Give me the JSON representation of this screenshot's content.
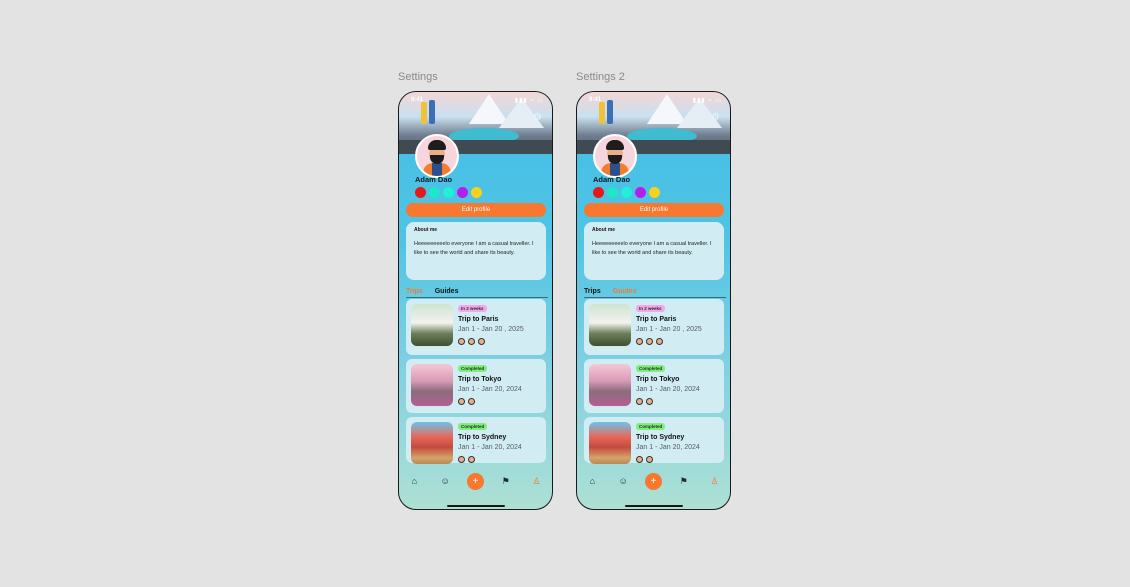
{
  "frames": [
    {
      "label": "Settings",
      "status": {
        "time": "9:41",
        "icons": "▮▮▮ ≈ ▭"
      },
      "profile": {
        "name": "Adam Dao",
        "color_dots": [
          "#e41a1a",
          "#1fe8c6",
          "#1ff0d7",
          "#b31fe8",
          "#f6d21a"
        ]
      },
      "edit_button": "Edit profile",
      "about": {
        "title": "About me",
        "text": "Heeeeeeeeelo everyone I am a casual traveller. I like to see the world and share its beauty."
      },
      "tabs": [
        {
          "label": "Trips",
          "active": true
        },
        {
          "label": "Guides",
          "active": false
        }
      ],
      "trips": [
        {
          "badge": "In 2 weeks",
          "badge_color": "#f3a6ec",
          "title": "Trip to Paris",
          "dates": "Jan 1 - Jan 20 , 2025",
          "people_count": 3
        },
        {
          "badge": "Completed",
          "badge_color": "#7cf07a",
          "title": "Trip to Tokyo",
          "dates": "Jan 1 - Jan 20, 2024",
          "people_count": 2
        },
        {
          "badge": "Completed",
          "badge_color": "#7cf07a",
          "title": "Trip to Sydney",
          "dates": "Jan 1 - Jan 20, 2024",
          "people_count": 2
        }
      ],
      "nav": [
        {
          "name": "home-icon",
          "glyph": "⌂"
        },
        {
          "name": "smile-icon",
          "glyph": "☺"
        },
        {
          "name": "add-icon",
          "glyph": "+"
        },
        {
          "name": "map-icon",
          "glyph": "⚑"
        },
        {
          "name": "profile-icon",
          "glyph": "♙"
        }
      ]
    },
    {
      "label": "Settings 2",
      "status": {
        "time": "9:41",
        "icons": "▮▮▮ ≈ ▭"
      },
      "profile": {
        "name": "Adam Dao",
        "color_dots": [
          "#e41a1a",
          "#1fe8c6",
          "#1ff0d7",
          "#b31fe8",
          "#f6d21a"
        ]
      },
      "edit_button": "Edit profile",
      "about": {
        "title": "About me",
        "text": "Heeeeeeeeelo everyone I am a casual traveller. I like to see the world and share its beauty."
      },
      "tabs": [
        {
          "label": "Trips",
          "active": false
        },
        {
          "label": "Guides",
          "active": true
        }
      ],
      "trips": [
        {
          "badge": "In 2 weeks",
          "badge_color": "#f3a6ec",
          "title": "Trip to Paris",
          "dates": "Jan 1 - Jan 20 , 2025",
          "people_count": 3
        },
        {
          "badge": "Completed",
          "badge_color": "#7cf07a",
          "title": "Trip to Tokyo",
          "dates": "Jan 1 - Jan 20, 2024",
          "people_count": 2
        },
        {
          "badge": "Completed",
          "badge_color": "#7cf07a",
          "title": "Trip to Sydney",
          "dates": "Jan 1 - Jan 20, 2024",
          "people_count": 2
        }
      ],
      "nav": [
        {
          "name": "home-icon",
          "glyph": "⌂"
        },
        {
          "name": "smile-icon",
          "glyph": "☺"
        },
        {
          "name": "add-icon",
          "glyph": "+"
        },
        {
          "name": "map-icon",
          "glyph": "⚑"
        },
        {
          "name": "profile-icon",
          "glyph": "♙"
        }
      ]
    }
  ],
  "colors": {
    "accent": "#f7782e",
    "card_bg": "#d2ecf4"
  }
}
